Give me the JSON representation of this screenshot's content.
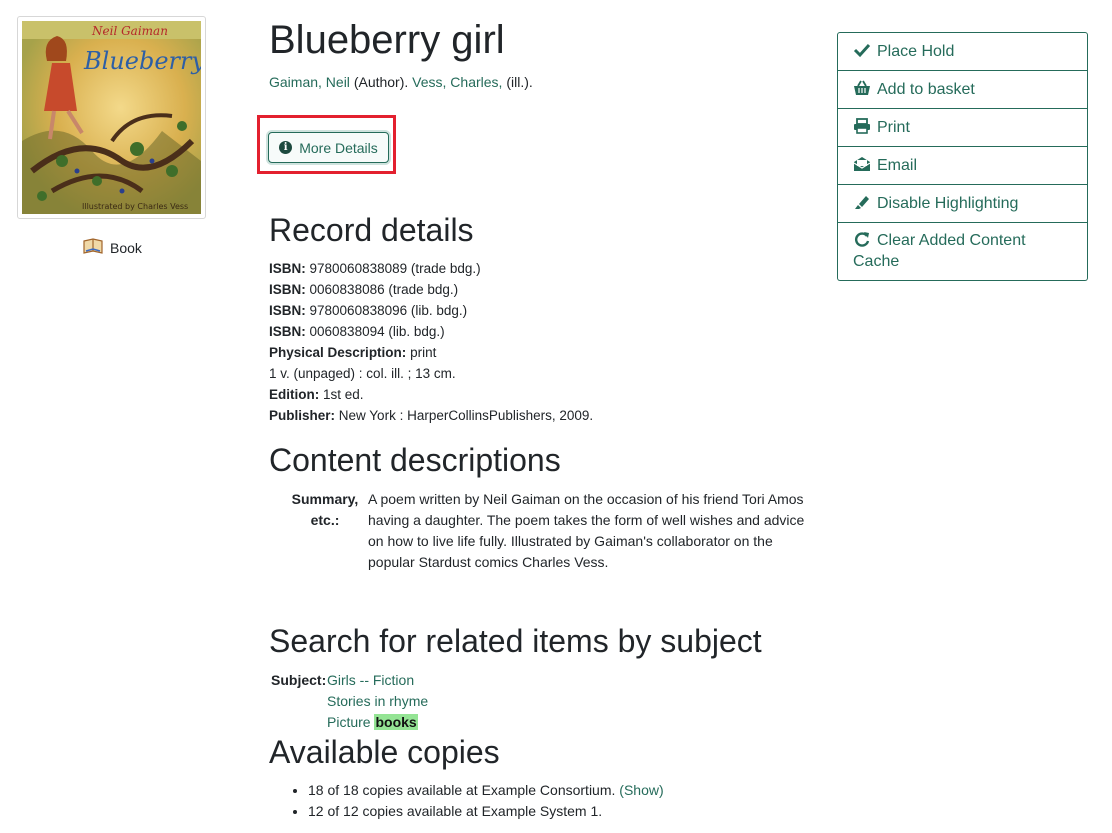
{
  "cover": {
    "author_text": "Neil Gaiman",
    "title_text": "Blueberry Girl",
    "illustrator_text": "Illustrated by Charles Vess"
  },
  "format": {
    "label": "Book",
    "icon": "book-icon"
  },
  "record": {
    "title": "Blueberry girl",
    "author_name": "Gaiman, Neil",
    "author_role": "(Author).",
    "illustrator_name": "Vess, Charles,",
    "illustrator_role": "(ill.).",
    "more_details_label": "More Details"
  },
  "record_details": {
    "heading": "Record details",
    "rows": [
      {
        "label": "ISBN:",
        "value": "9780060838089 (trade bdg.)"
      },
      {
        "label": "ISBN:",
        "value": "0060838086 (trade bdg.)"
      },
      {
        "label": "ISBN:",
        "value": "9780060838096 (lib. bdg.)"
      },
      {
        "label": "ISBN:",
        "value": "0060838094 (lib. bdg.)"
      },
      {
        "label": "Physical Description:",
        "value": "print"
      },
      {
        "label": "",
        "value": "1 v. (unpaged) : col. ill. ; 13 cm."
      },
      {
        "label": "Edition:",
        "value": "1st ed."
      },
      {
        "label": "Publisher:",
        "value": "New York : HarperCollinsPublishers, 2009."
      }
    ]
  },
  "content": {
    "heading": "Content descriptions",
    "summary_label": "Summary, etc.:",
    "summary_text": "A poem written by Neil Gaiman on the occasion of his friend Tori Amos having a daughter. The poem takes the form of well wishes and advice on how to live life fully. Illustrated by Gaiman's collaborator on the popular Stardust comics Charles Vess."
  },
  "subjects": {
    "heading": "Search for related items by subject",
    "label": "Subject:",
    "items": [
      "Girls -- Fiction",
      "Stories in rhyme"
    ],
    "picture_prefix": "Picture",
    "picture_highlight": "books"
  },
  "copies": {
    "heading": "Available copies",
    "line1": "18 of 18 copies available at Example Consortium.",
    "show_label": "(Show)",
    "line2": "12 of 12 copies available at Example System 1."
  },
  "actions": [
    {
      "label": "Place Hold",
      "icon": "check-icon"
    },
    {
      "label": "Add to basket",
      "icon": "basket-icon"
    },
    {
      "label": "Print",
      "icon": "print-icon"
    },
    {
      "label": "Email",
      "icon": "envelope-icon"
    },
    {
      "label": "Disable Highlighting",
      "icon": "highlighter-icon"
    },
    {
      "label": "Clear Added Content Cache",
      "icon": "refresh-icon"
    }
  ],
  "colors": {
    "link": "#256b5a",
    "highlight_box": "#e3202f",
    "search_highlight": "#94e494"
  }
}
